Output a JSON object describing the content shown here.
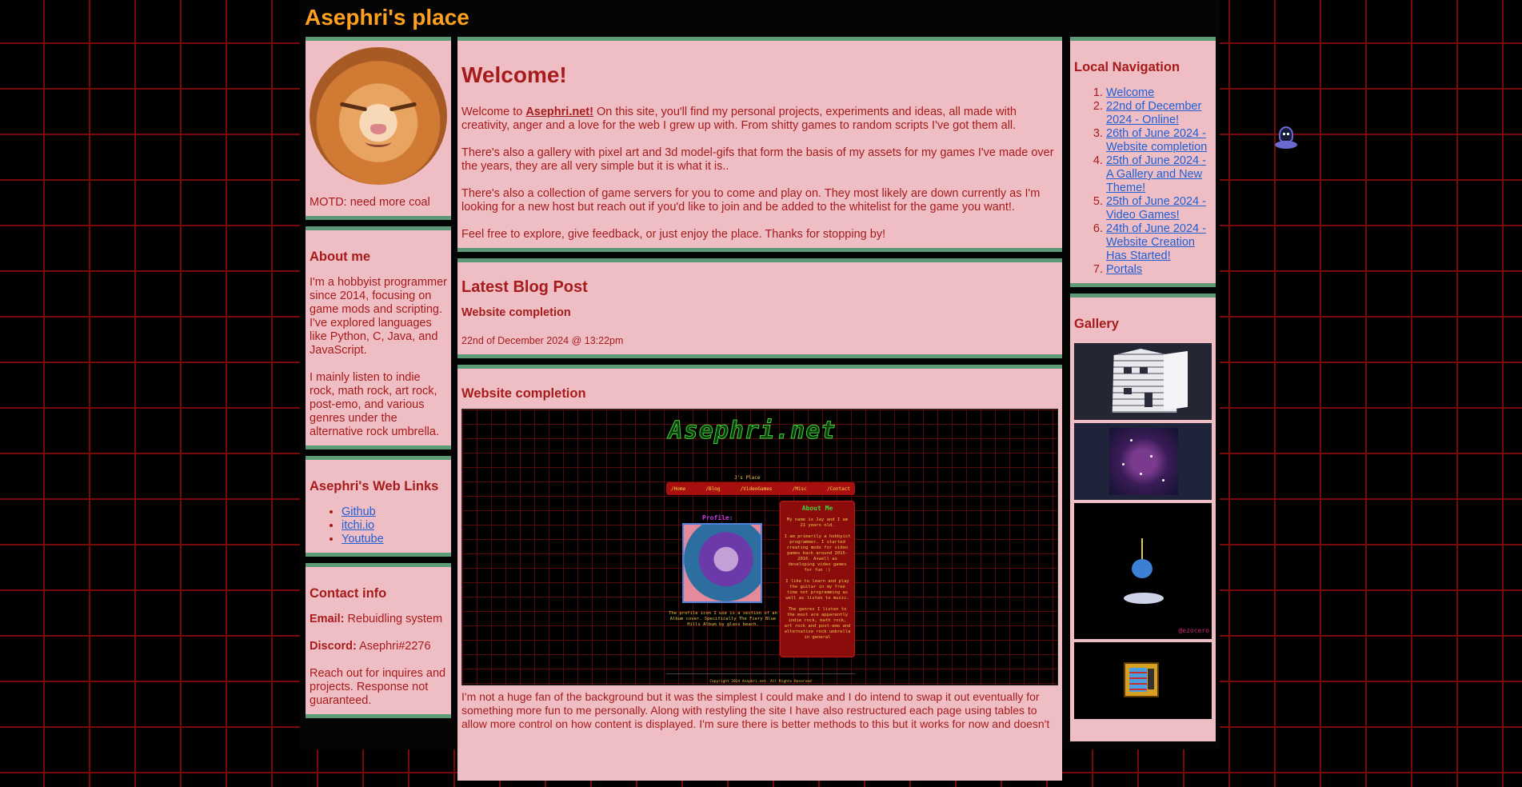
{
  "site": {
    "title": "Asephri's place"
  },
  "left": {
    "motd": "MOTD: need more coal",
    "about": {
      "title": "About me",
      "p1": "I'm a hobbyist programmer since 2014, focusing on game mods and scripting. I've explored languages like Python, C, Java, and JavaScript.",
      "p2": "I mainly listen to indie rock, math rock, art rock, post-emo, and various genres under the alternative rock umbrella."
    },
    "links": {
      "title": "Asephri's Web Links",
      "items": [
        "Github",
        "itchi.io",
        "Youtube"
      ]
    },
    "contact": {
      "title": "Contact info",
      "email_label": "Email:",
      "email_value": "Rebuidling system",
      "discord_label": "Discord:",
      "discord_value": "Asephri#2276",
      "note": "Reach out for inquires and projects. Response not guaranteed."
    }
  },
  "center": {
    "welcome": {
      "title": "Welcome!",
      "p1_prefix": "Welcome to ",
      "p1_link": "Asephri.net!",
      "p1_suffix": " On this site, you'll find my personal projects, experiments and ideas, all made with creativity, anger and a love for the web I grew up with. From shitty games to random scripts I've got them all.",
      "p2": "There's also a gallery with pixel art and 3d model-gifs that form the basis of my assets for my games I've made over the years, they are all very simple but it is what it is..",
      "p3": "There's also a collection of game servers for you to come and play on. They most likely are down currently as I'm looking for a new host but reach out if you'd like to join and be added to the whitelist for the game you want!.",
      "p4": "Feel free to explore, give feedback, or just enjoy the place. Thanks for stopping by!"
    },
    "latest": {
      "title": "Latest Blog Post",
      "post_title": "Website completion",
      "date": "22nd of December 2024 @ 13:22pm"
    },
    "completion": {
      "title": "Website completion",
      "screenshot": {
        "logo": "Asephri.net",
        "subtitle": "J's Place",
        "nav": [
          "/Home",
          "/Blog",
          "/VideoGames",
          "/Misc",
          "/Contact"
        ],
        "profile_label": "Profile:",
        "album_caption": "The profile icon I use is a section of an Album cover. Specifically The Fiery Blue Hills Album by glass beach.",
        "about_title": "About Me",
        "about_p1": "My name is Jay and I am 21 years old.",
        "about_p2": "I am primarily a hobbyist programmer. I started creating mods for video games back around 2015-2016. Aswell as developing video games for fun :)",
        "about_p3": "I like to learn and play the guitar in my free time not programming as well as listen to music.",
        "about_p4": "The genres I listen to the most are apparently indie rock, math rock, art rock and post-emo and alternative rock umbrella in general",
        "footer": "Copyright 2024 Asephri.net. All Rights Reserved"
      },
      "text": "I'm not a huge fan of the background but it was the simplest I could make and I do intend to swap it out eventually for something more fun to me personally. Along with restyling the site I have also restructured each page using tables to allow more control on how content is displayed. I'm sure there is better methods to this but it works for now and doesn't"
    }
  },
  "right": {
    "nav": {
      "title": "Local Navigation",
      "items": [
        "Welcome",
        "22nd of December 2024 - Online!",
        "26th of June 2024 - Website completion",
        "25th of June 2024 - A Gallery and New Theme!",
        "25th of June 2024 - Video Games!",
        "24th of June 2024 - Website Creation Has Started!",
        "Portals"
      ]
    },
    "gallery": {
      "title": "Gallery",
      "robot_signature": "@ezocero"
    }
  }
}
